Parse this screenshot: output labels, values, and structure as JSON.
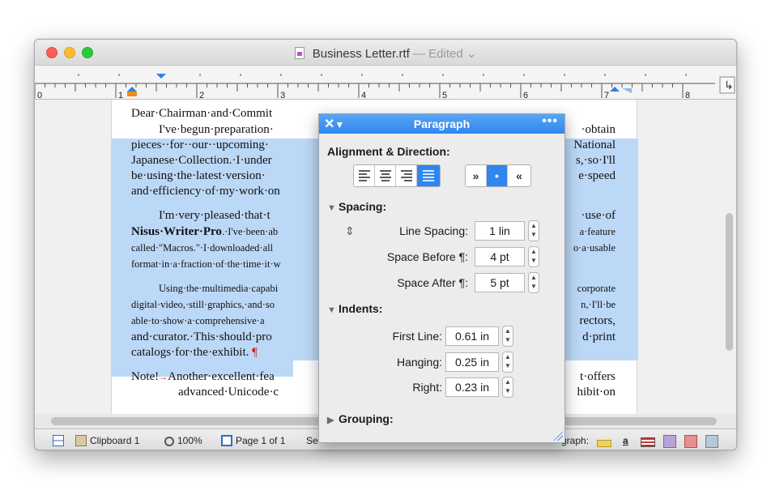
{
  "window": {
    "title": "Business Letter.rtf",
    "title_separator": "—",
    "edited_label": "Edited",
    "edited_chevron": "⌄"
  },
  "ruler": {
    "numbers": [
      "0",
      "1",
      "2",
      "3",
      "4",
      "5",
      "6",
      "7",
      "8"
    ],
    "return_icon": "↳"
  },
  "document": {
    "para1": {
      "line1": "Dear·Chairman·and·Commit",
      "line2_left": "I've·begun·preparation·",
      "line2_right": "·obtain",
      "line3_left": "pieces··for··our··upcoming·",
      "line3_right": "National",
      "line4_left": "Japanese·Collection.·I·under",
      "line4_right": "s,·so·I'll",
      "line5_left": "be·using·the·latest·version·",
      "line5_right": "e·speed",
      "line6_left": "and·efficiency·of·my·work·on",
      "line6_right": ""
    },
    "para2": {
      "line1_left": "I'm·very·pleased·that·t",
      "line1_right": "·use·of",
      "line2_bold": "Nisus·Writer·Pro",
      "line2_left": ".·I've·been·ab",
      "line2_right": "a·feature",
      "line3_left": "called·\"Macros.\"·I·downloaded·all",
      "line3_right": "o·a·usable",
      "line4_left": "format·in·a·fraction·of·the·time·it·w",
      "line4_right": ""
    },
    "para3": {
      "line1_left": "Using·the·multimedia·capabi",
      "line1_right": "corporate",
      "line2_left": "digital·video,·still·graphics,·and·so",
      "line2_right": "n,·I'll·be",
      "line3_left": "able·to·show·a·comprehensive·a",
      "line3_right": "rectors,",
      "line4_left": "and·curator.·This·should·pro",
      "line4_right": "d·print",
      "line5": "catalogs·for·the·exhibit.",
      "pilcrow": "¶"
    },
    "para4": {
      "line1_left": "Note!",
      "tab_arrow": "→",
      "line1_mid": "Another·excellent·fea",
      "line1_right": "t·offers",
      "line2_left": "advanced·Unicode·c",
      "line2_right": "hibit·on"
    }
  },
  "statusbar": {
    "clipboard": "Clipboard 1",
    "zoom": "100%",
    "page": "Page 1 of 1",
    "style_prefix": "Se",
    "paragraph_style": "graph:",
    "underline_a": "a"
  },
  "palette": {
    "close_glyph": "✕",
    "menu_glyph": "▼",
    "title": "Paragraph",
    "more_glyph": "•••",
    "alignment_header": "Alignment & Direction:",
    "direction_left": "»",
    "direction_dot": "•",
    "direction_right": "«",
    "spacing_header": "Spacing:",
    "line_spacing_label": "Line Spacing:",
    "line_spacing_value": "1 lin",
    "space_before_label": "Space Before ¶:",
    "space_before_value": "4 pt",
    "space_after_label": "Space After ¶:",
    "space_after_value": "5 pt",
    "indents_header": "Indents:",
    "first_line_label": "First Line:",
    "first_line_value": "0.61 in",
    "hanging_label": "Hanging:",
    "hanging_value": "0.25 in",
    "right_label": "Right:",
    "right_value": "0.23 in",
    "grouping_header": "Grouping:",
    "expanded_glyph": "▼",
    "collapsed_glyph": "▶",
    "stepper_up": "▲",
    "stepper_down": "▼",
    "updown_glyph": "⇕"
  },
  "colors": {
    "selection": "#bcd8f7",
    "accent": "#2f86ef",
    "pilcrow": "#c8242a"
  }
}
